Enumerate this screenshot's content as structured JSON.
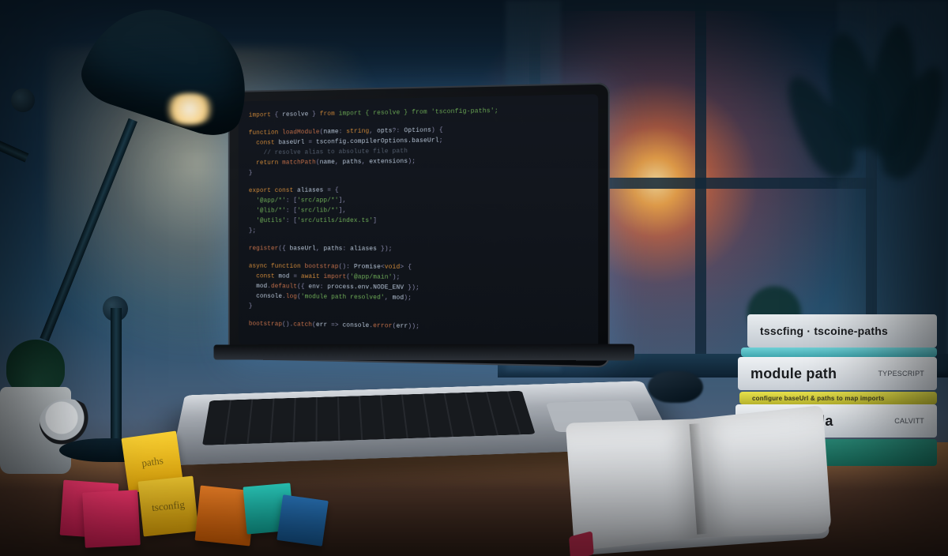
{
  "scene": {
    "description": "Evening home-office desk: laptop showing code editor, desk lamp, sunset through window, stack of programming books, sticky notes, open notebook",
    "lighting_accent_hex": "#ffb347",
    "sunset_center_hex": "#ffd27a",
    "ambient_hex": "#15354c"
  },
  "laptop_code": {
    "lines": [
      "import { resolve } from 'tsconfig-paths';",
      "",
      "function loadModule(name: string, opts?: Options) {",
      "  const baseUrl = tsconfig.compilerOptions.baseUrl;",
      "  // resolve alias to absolute file path",
      "  return matchPath(name, paths, extensions);",
      "}",
      "",
      "export const aliases = {",
      "  '@app/*': ['src/app/*'],",
      "  '@lib/*': ['src/lib/*'],",
      "  '@utils': ['src/utils/index.ts']",
      "};",
      "",
      "register({ baseUrl, paths: aliases });",
      "",
      "async function bootstrap(): Promise<void> {",
      "  const mod = await import('@app/main');",
      "  mod.default({ env: process.env.NODE_ENV });",
      "  console.log('module path resolved', mod);",
      "}",
      "",
      "bootstrap().catch(err => console.error(err));"
    ]
  },
  "books": {
    "top": {
      "title": "tsscfing · tscoine-paths",
      "aside": ""
    },
    "upper": {
      "title": "module path",
      "aside": "TYPESCRIPT"
    },
    "thin_caption": "configure baseUrl & paths to map imports",
    "lower": {
      "title": "thocullaletla",
      "aside": "CALVITT"
    }
  },
  "sticky_notes": {
    "visible_labels": [
      "paths",
      "tsconfig"
    ]
  }
}
